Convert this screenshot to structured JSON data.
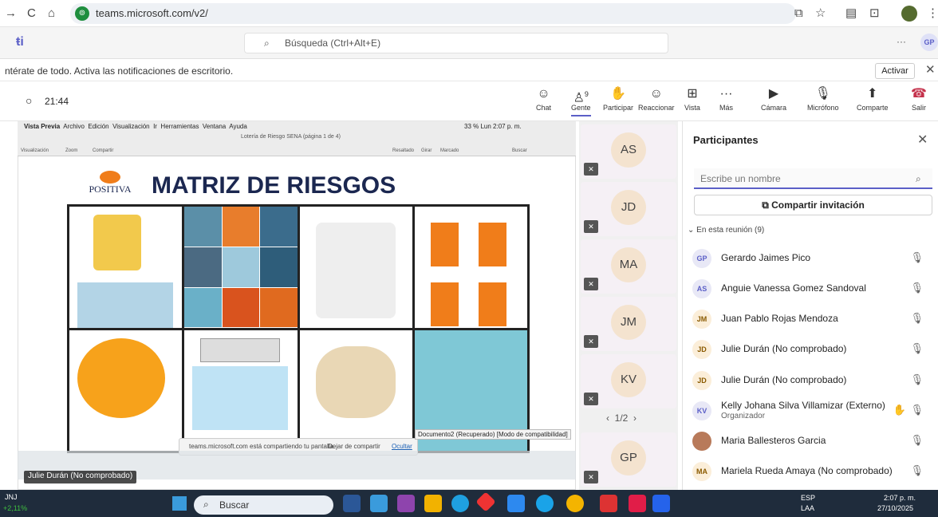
{
  "browser": {
    "url": "teams.microsoft.com/v2/",
    "profile": "GP"
  },
  "teams": {
    "search_placeholder": "Búsqueda (Ctrl+Alt+E)",
    "more": "···"
  },
  "notification": {
    "text": "ntérate de todo. Activa las notificaciones de escritorio.",
    "button": "Activar"
  },
  "meeting": {
    "timer": "21:44",
    "tools": [
      {
        "label": "Chat",
        "icon": "chat-icon"
      },
      {
        "label": "Gente",
        "icon": "people-icon",
        "count": "9"
      },
      {
        "label": "Participar",
        "icon": "raise-hand-icon"
      },
      {
        "label": "Reaccionar",
        "icon": "react-icon"
      },
      {
        "label": "Vista",
        "icon": "view-icon"
      },
      {
        "label": "Más",
        "icon": "more-icon"
      },
      {
        "label": "Cámara",
        "icon": "camera-off-icon"
      },
      {
        "label": "Micrófono",
        "icon": "mic-off-icon"
      },
      {
        "label": "Comparte",
        "icon": "share-icon"
      },
      {
        "label": "Salir",
        "icon": "hangup-icon"
      }
    ]
  },
  "shared": {
    "mac_menu": [
      "Vista Previa",
      "Archivo",
      "Edición",
      "Visualización",
      "Ir",
      "Herramientas",
      "Ventana",
      "Ayuda"
    ],
    "mac_status": "33 %  Lun 2:07 p. m.",
    "doc_window_title": "Lotería de Riesgo SENA (página 1 de 4)",
    "toolbar_labels": [
      "Visualización",
      "Zoom",
      "Compartir",
      "Resaltado",
      "Girar",
      "Marcado",
      "Buscar"
    ],
    "logo": "POSITIVA",
    "title": "MATRIZ DE RIESGOS",
    "share_notice": "teams.microsoft.com está compartiendo tu pantalla.",
    "stop_sharing": "Dejar de compartir",
    "hide": "Ocultar",
    "tooltip": "Documento2 (Recuperado) [Modo de compatibilidad]",
    "nametag": "Julie Durán (No comprobado)"
  },
  "tiles": [
    {
      "initials": "AS"
    },
    {
      "initials": "JD"
    },
    {
      "initials": "MA"
    },
    {
      "initials": "JM"
    },
    {
      "initials": "KV"
    },
    {
      "initials": "GP"
    }
  ],
  "pager": "1/2",
  "panel": {
    "title": "Participantes",
    "search_placeholder": "Escribe un nombre",
    "invite": "Compartir invitación",
    "section": "En esta reunión (9)",
    "participants": [
      {
        "initials": "GP",
        "name": "Gerardo Jaimes Pico",
        "color": "#e8e8f6"
      },
      {
        "initials": "AS",
        "name": "Anguie Vanessa Gomez Sandoval",
        "color": "#e8e8f6"
      },
      {
        "initials": "JM",
        "name": "Juan Pablo Rojas Mendoza",
        "color": "#fbeed9"
      },
      {
        "initials": "JD",
        "name": "Julie Durán (No comprobado)",
        "color": "#fbeed9"
      },
      {
        "initials": "JD",
        "name": "Julie Durán (No comprobado)",
        "color": "#fbeed9"
      },
      {
        "initials": "KV",
        "name": "Kelly Johana Silva Villamizar (Externo)",
        "role": "Organizador",
        "color": "#e8e8f6"
      },
      {
        "initials": "",
        "name": "Maria Ballesteros Garcia",
        "color": "#b87a5a"
      },
      {
        "initials": "MA",
        "name": "Mariela Rueda Amaya (No comprobado)",
        "color": "#fbeed9"
      }
    ]
  },
  "taskbar": {
    "weather": "JNJ",
    "weather_change": "+2,11%",
    "search": "Buscar",
    "lang": "ESP",
    "lang2": "LAA",
    "time": "2:07 p. m.",
    "date": "27/10/2025"
  }
}
